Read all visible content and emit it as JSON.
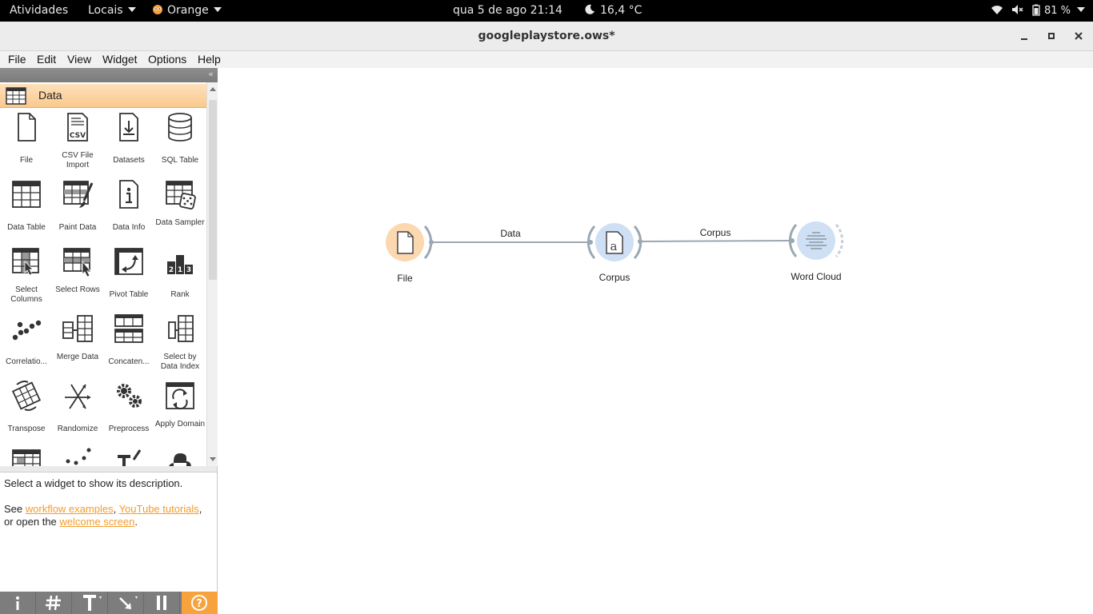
{
  "topbar": {
    "activities": "Atividades",
    "places": "Locais",
    "app": "Orange",
    "clock": "qua 5 de ago  21:14",
    "weather": "16,4 °C",
    "battery": "81 %"
  },
  "window": {
    "title": "googleplaystore.ows*"
  },
  "menu": {
    "file": "File",
    "edit": "Edit",
    "view": "View",
    "widget": "Widget",
    "options": "Options",
    "help": "Help"
  },
  "toolbox": {
    "category": "Data",
    "widgets": [
      {
        "label": "File",
        "icon": "file-icon"
      },
      {
        "label": "CSV File Import",
        "icon": "csv-icon"
      },
      {
        "label": "Datasets",
        "icon": "datasets-icon"
      },
      {
        "label": "SQL Table",
        "icon": "database-icon"
      },
      {
        "label": "Data Table",
        "icon": "table-icon"
      },
      {
        "label": "Paint Data",
        "icon": "paint-data-icon"
      },
      {
        "label": "Data Info",
        "icon": "info-icon"
      },
      {
        "label": "Data Sampler",
        "icon": "dice-table-icon"
      },
      {
        "label": "Select Columns",
        "icon": "select-columns-icon"
      },
      {
        "label": "Select Rows",
        "icon": "select-rows-icon"
      },
      {
        "label": "Pivot Table",
        "icon": "pivot-icon"
      },
      {
        "label": "Rank",
        "icon": "rank-icon"
      },
      {
        "label": "Correlatio...",
        "icon": "correlations-icon"
      },
      {
        "label": "Merge Data",
        "icon": "merge-icon"
      },
      {
        "label": "Concaten...",
        "icon": "concatenate-icon"
      },
      {
        "label": "Select by Data Index",
        "icon": "select-index-icon"
      },
      {
        "label": "Transpose",
        "icon": "transpose-icon"
      },
      {
        "label": "Randomize",
        "icon": "randomize-icon"
      },
      {
        "label": "Preprocess",
        "icon": "gears-icon"
      },
      {
        "label": "Apply Domain",
        "icon": "apply-domain-icon"
      }
    ]
  },
  "description": {
    "line1": "Select a widget to show its description.",
    "see": "See ",
    "link_examples": "workflow examples",
    "comma": ", ",
    "link_tutorials": "YouTube tutorials",
    "comma2": ",",
    "or_open": "or open the ",
    "link_welcome": "welcome screen",
    "period": "."
  },
  "canvas": {
    "nodes": [
      {
        "label": "File",
        "icon": "file-icon",
        "color": "#fbd8b0"
      },
      {
        "label": "Corpus",
        "icon": "corpus-icon",
        "color": "#cfe0f5"
      },
      {
        "label": "Word Cloud",
        "icon": "word-cloud-icon",
        "color": "#cfe0f5"
      }
    ],
    "links": [
      {
        "label": "Data"
      },
      {
        "label": "Corpus"
      }
    ]
  },
  "colors": {
    "accent_orange": "#f7a23c",
    "text_link": "#f39c2c"
  }
}
